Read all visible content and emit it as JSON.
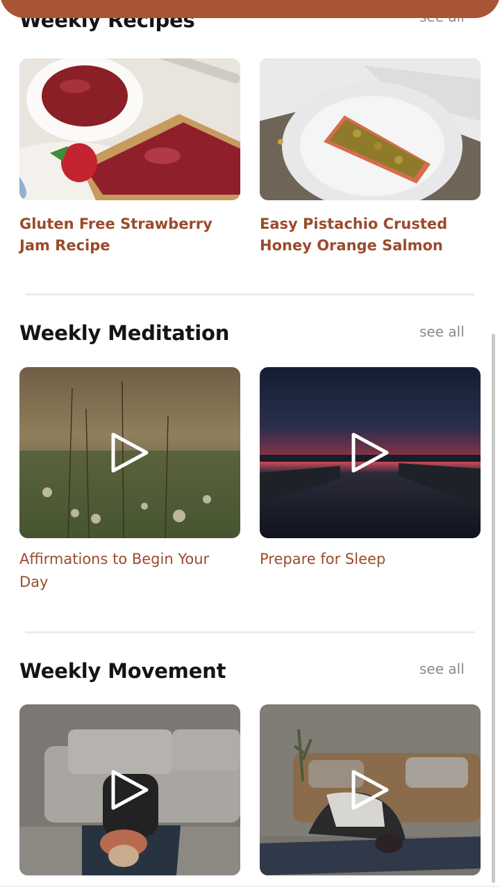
{
  "recipes": {
    "title": "Weekly Recipes",
    "see_all": "see all",
    "items": [
      {
        "title": "Gluten Free Strawberry Jam Recipe"
      },
      {
        "title": "Easy Pistachio Crusted Honey Orange Salmon"
      }
    ]
  },
  "meditation": {
    "title": "Weekly Meditation",
    "see_all": "see all",
    "items": [
      {
        "title": "Affirmations to Begin Your Day"
      },
      {
        "title": "Prepare for Sleep"
      }
    ]
  },
  "movement": {
    "title": "Weekly Movement",
    "see_all": "see all"
  },
  "colors": {
    "accent": "#a85536",
    "card_title": "#9a4b2d",
    "see_all": "#8a8a8a"
  }
}
